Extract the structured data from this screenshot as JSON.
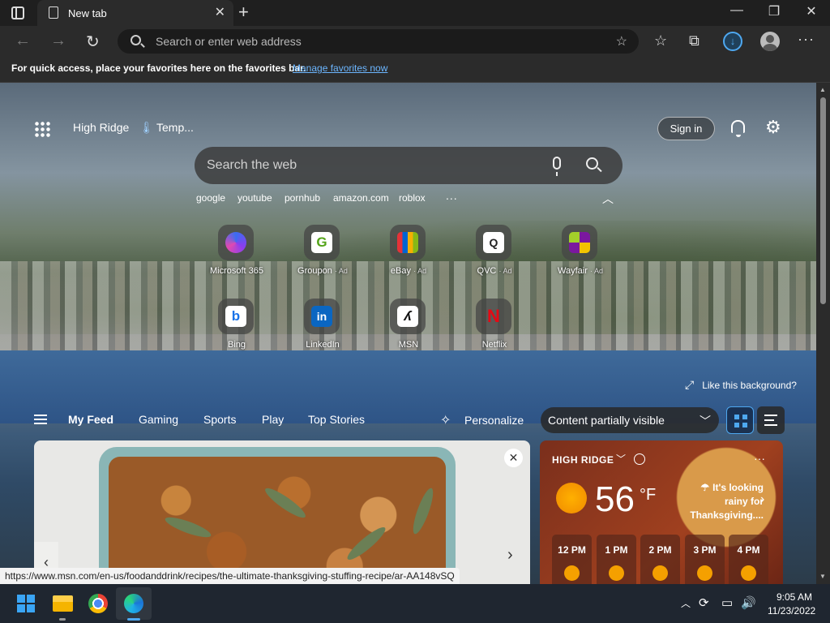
{
  "browser": {
    "tab_title": "New tab",
    "address_placeholder": "Search or enter web address",
    "favorites_bar_text": "For quick access, place your favorites here on the favorites bar.",
    "favorites_bar_link": "Manage favorites now"
  },
  "page": {
    "location": "High Ridge",
    "temperature_label": "Temp...",
    "sign_in_label": "Sign in",
    "search_placeholder": "Search the web",
    "suggestions": [
      "google",
      "youtube",
      "pornhub",
      "amazon.com",
      "roblox"
    ],
    "suggestions_more": "...",
    "quick_links": [
      {
        "name": "Microsoft 365",
        "ad": "",
        "logo_color": "#4a2a9a"
      },
      {
        "name": "Groupon",
        "ad": "· Ad",
        "logo_color": "#53a318",
        "glyph": "G"
      },
      {
        "name": "eBay",
        "ad": "· Ad",
        "logo_color": "#e53238"
      },
      {
        "name": "QVC",
        "ad": "· Ad",
        "logo_color": "#ffffff",
        "glyph": "Q"
      },
      {
        "name": "Wayfair",
        "ad": "· Ad",
        "logo_color": "#7b189f"
      },
      {
        "name": "Bing",
        "ad": "",
        "logo_color": "#ffffff",
        "glyph": "b"
      },
      {
        "name": "LinkedIn",
        "ad": "",
        "logo_color": "#0a66c2",
        "glyph": "in"
      },
      {
        "name": "MSN",
        "ad": "",
        "logo_color": "#111111"
      },
      {
        "name": "Netflix",
        "ad": "",
        "logo_color": "#e50914",
        "glyph": "N"
      }
    ],
    "like_background": "Like this background?",
    "feed_tabs": [
      "My Feed",
      "Gaming",
      "Sports",
      "Play",
      "Top Stories"
    ],
    "personalize_label": "Personalize",
    "content_visibility": "Content partially visible"
  },
  "weather": {
    "location": "HIGH RIDGE",
    "temperature": "56",
    "unit": "°F",
    "message": "It's looking rainy for Thanksgiving....",
    "hours": [
      "12 PM",
      "1 PM",
      "2 PM",
      "3 PM",
      "4 PM"
    ]
  },
  "status_url": "https://www.msn.com/en-us/foodanddrink/recipes/the-ultimate-thanksgiving-stuffing-recipe/ar-AA148vSQ",
  "taskbar": {
    "time": "9:05 AM",
    "date": "11/23/2022"
  },
  "colors": {
    "accent": "#4ea8f0",
    "link": "#6cb6ff"
  }
}
